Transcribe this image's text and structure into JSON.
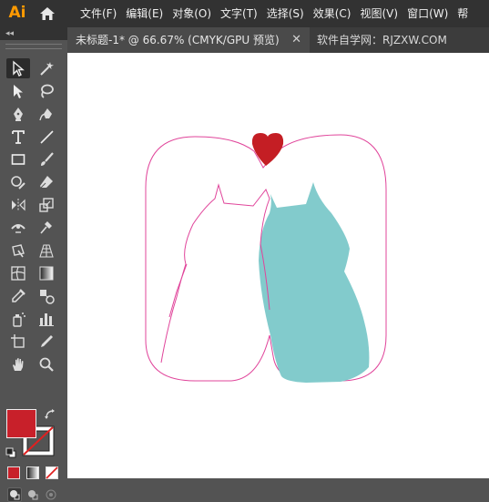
{
  "app": {
    "logo": "Ai"
  },
  "menu": {
    "items": [
      "文件(F)",
      "编辑(E)",
      "对象(O)",
      "文字(T)",
      "选择(S)",
      "效果(C)",
      "视图(V)",
      "窗口(W)",
      "帮"
    ]
  },
  "toolbar": {
    "collapse_label": "◂◂"
  },
  "tabs": {
    "active_label": "未标题-1* @ 66.67% (CMYK/GPU 预览)",
    "close_label": "✕",
    "inactive_label": "软件自学网：RJZXW.COM"
  },
  "tools": [
    {
      "name": "selection-tool-icon"
    },
    {
      "name": "magic-wand-tool-icon"
    },
    {
      "name": "direct-selection-tool-icon"
    },
    {
      "name": "lasso-tool-icon"
    },
    {
      "name": "pen-tool-icon"
    },
    {
      "name": "curvature-tool-icon"
    },
    {
      "name": "type-tool-icon"
    },
    {
      "name": "line-segment-tool-icon"
    },
    {
      "name": "rectangle-tool-icon"
    },
    {
      "name": "paintbrush-tool-icon"
    },
    {
      "name": "shaper-tool-icon"
    },
    {
      "name": "eraser-tool-icon"
    },
    {
      "name": "reflect-tool-icon"
    },
    {
      "name": "scale-tool-icon"
    },
    {
      "name": "width-tool-icon"
    },
    {
      "name": "puppet-warp-tool-icon"
    },
    {
      "name": "free-transform-tool-icon"
    },
    {
      "name": "perspective-grid-tool-icon"
    },
    {
      "name": "mesh-tool-icon"
    },
    {
      "name": "gradient-tool-icon"
    },
    {
      "name": "eyedropper-tool-icon"
    },
    {
      "name": "blend-tool-icon"
    },
    {
      "name": "symbol-sprayer-tool-icon"
    },
    {
      "name": "column-graph-tool-icon"
    },
    {
      "name": "artboard-tool-icon"
    },
    {
      "name": "slice-tool-icon"
    },
    {
      "name": "hand-tool-icon"
    },
    {
      "name": "zoom-tool-icon"
    }
  ],
  "colors": {
    "fill": "#c8202a",
    "heart": "#c41e24",
    "outline": "#e0449a",
    "cat_right": "#82cbcc",
    "accent": "#ff9a00"
  }
}
